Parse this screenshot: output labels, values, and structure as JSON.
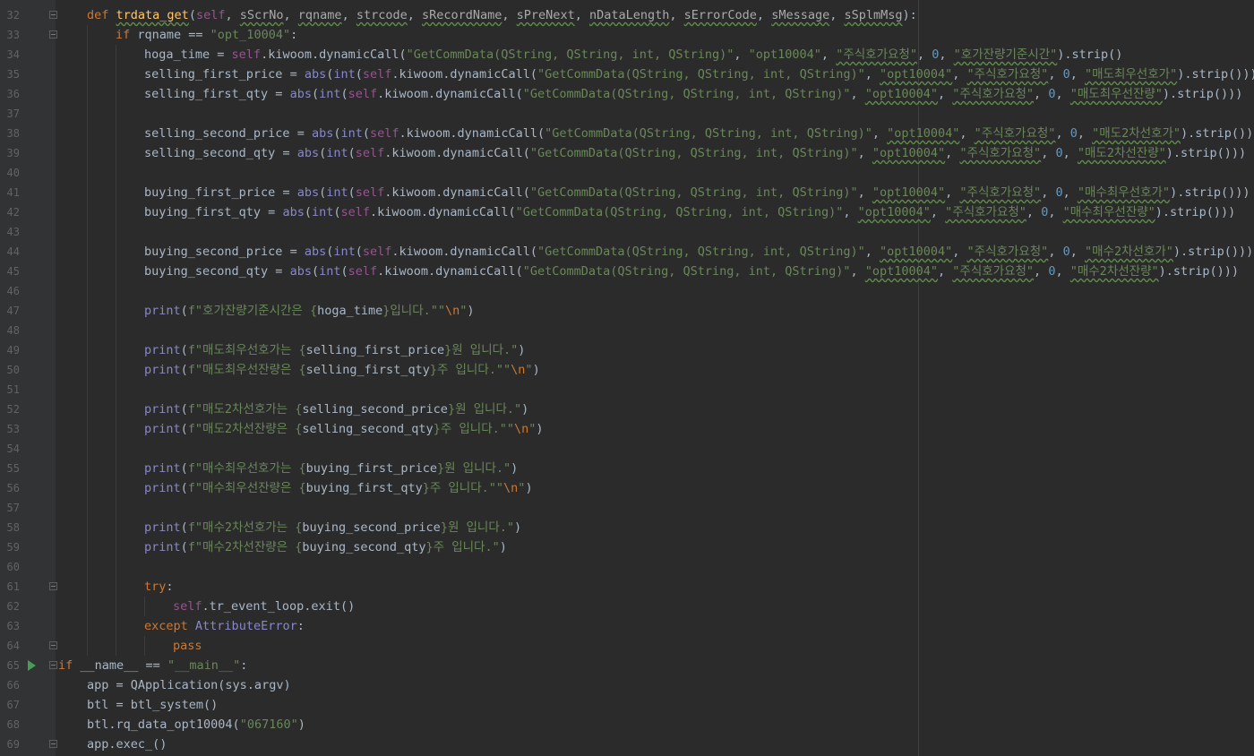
{
  "colors": {
    "background": "#2b2b2b",
    "gutter": "#313335",
    "line_number": "#606366",
    "keyword": "#cc7832",
    "self": "#94558d",
    "function_name": "#ffc66d",
    "string": "#6a8759",
    "number": "#6897bb",
    "builtin": "#8888c6",
    "default_text": "#a9b7c6"
  },
  "line_numbers": [
    "32",
    "33",
    "34",
    "35",
    "36",
    "37",
    "38",
    "39",
    "40",
    "41",
    "42",
    "43",
    "44",
    "45",
    "46",
    "47",
    "48",
    "49",
    "50",
    "51",
    "52",
    "53",
    "54",
    "55",
    "56",
    "57",
    "58",
    "59",
    "60",
    "61",
    "62",
    "63",
    "64",
    "65",
    "66",
    "67",
    "68",
    "69"
  ],
  "tokens": {
    "def": "def",
    "if": "if",
    "try": "try",
    "except": "except",
    "pass": "pass",
    "self": "self",
    "abs": "abs",
    "int": "int",
    "print": "print",
    "fn_name": "trdata_get",
    "params": [
      "sScrNo",
      "rqname",
      "strcode",
      "sRecordName",
      "sPreNext",
      "nDataLength",
      "sErrorCode",
      "sMessage",
      "sSplmMsg"
    ],
    "rq_str": "\"opt_10004\"",
    "call_sig": "\"GetCommData(QString, QString, int, QString)\"",
    "opt": "\"opt10004\"",
    "req_name": "\"주식호가요청\"",
    "zero": "0",
    "kiwoom_call": ".kiwoom.dynamicCall(",
    "strip_close1": ").strip()",
    "strip_close2": ").strip()))",
    "exc_class": "AttributeError",
    "main_str": "\"__main__\"",
    "code_str": "\"067160\""
  },
  "fields": {
    "f34": "\"호가잔량기준시간\"",
    "f35": "\"매도최우선호가\"",
    "f36": "\"매도최우선잔량\"",
    "f38": "\"매도2차선호가\"",
    "f39": "\"매도2차선잔량\"",
    "f41": "\"매수최우선호가\"",
    "f42": "\"매수최우선잔량\"",
    "f44": "\"매수2차선호가\"",
    "f45": "\"매수2차선잔량\""
  },
  "vars": {
    "v34": "hoga_time",
    "v35": "selling_first_price",
    "v36": "selling_first_qty",
    "v38": "selling_second_price",
    "v39": "selling_second_qty",
    "v41": "buying_first_price",
    "v42": "buying_first_qty",
    "v44": "buying_second_price",
    "v45": "buying_second_qty"
  },
  "prints": {
    "p47a": "f\"호가잔량기준시간은 {",
    "p47b": "}입니다.\"\"",
    "p49a": "f\"매도최우선호가는 {",
    "p49b": "}원 입니다.\"",
    "p50a": "f\"매도최우선잔량은 {",
    "p50b": "}주 입니다.\"\"",
    "p52a": "f\"매도2차선호가는 {",
    "p52b": "}원 입니다.\"",
    "p53a": "f\"매도2차선잔량은 {",
    "p53b": "}주 입니다.\"\"",
    "p55a": "f\"매수최우선호가는 {",
    "p55b": "}원 입니다.\"",
    "p56a": "f\"매수최우선잔량은 {",
    "p56b": "}주 입니다.\"\"",
    "p58a": "f\"매수2차선호가는 {",
    "p58b": "}원 입니다.\"",
    "p59a": "f\"매수2차선잔량은 {",
    "p59b": "}주 입니다.\"",
    "nl": "\\n",
    "q": "\""
  },
  "misc": {
    "rqname_eq": " rqname == ",
    "tr_exit": ".tr_event_loop.exit()",
    "name_dunder": " __name__ == ",
    "app_line": "app = QApplication(sys.argv)",
    "btl_line": "btl = btl_system()",
    "btl_call": "btl.rq_data_opt10004(",
    "app_exec": "app.exec_()"
  }
}
